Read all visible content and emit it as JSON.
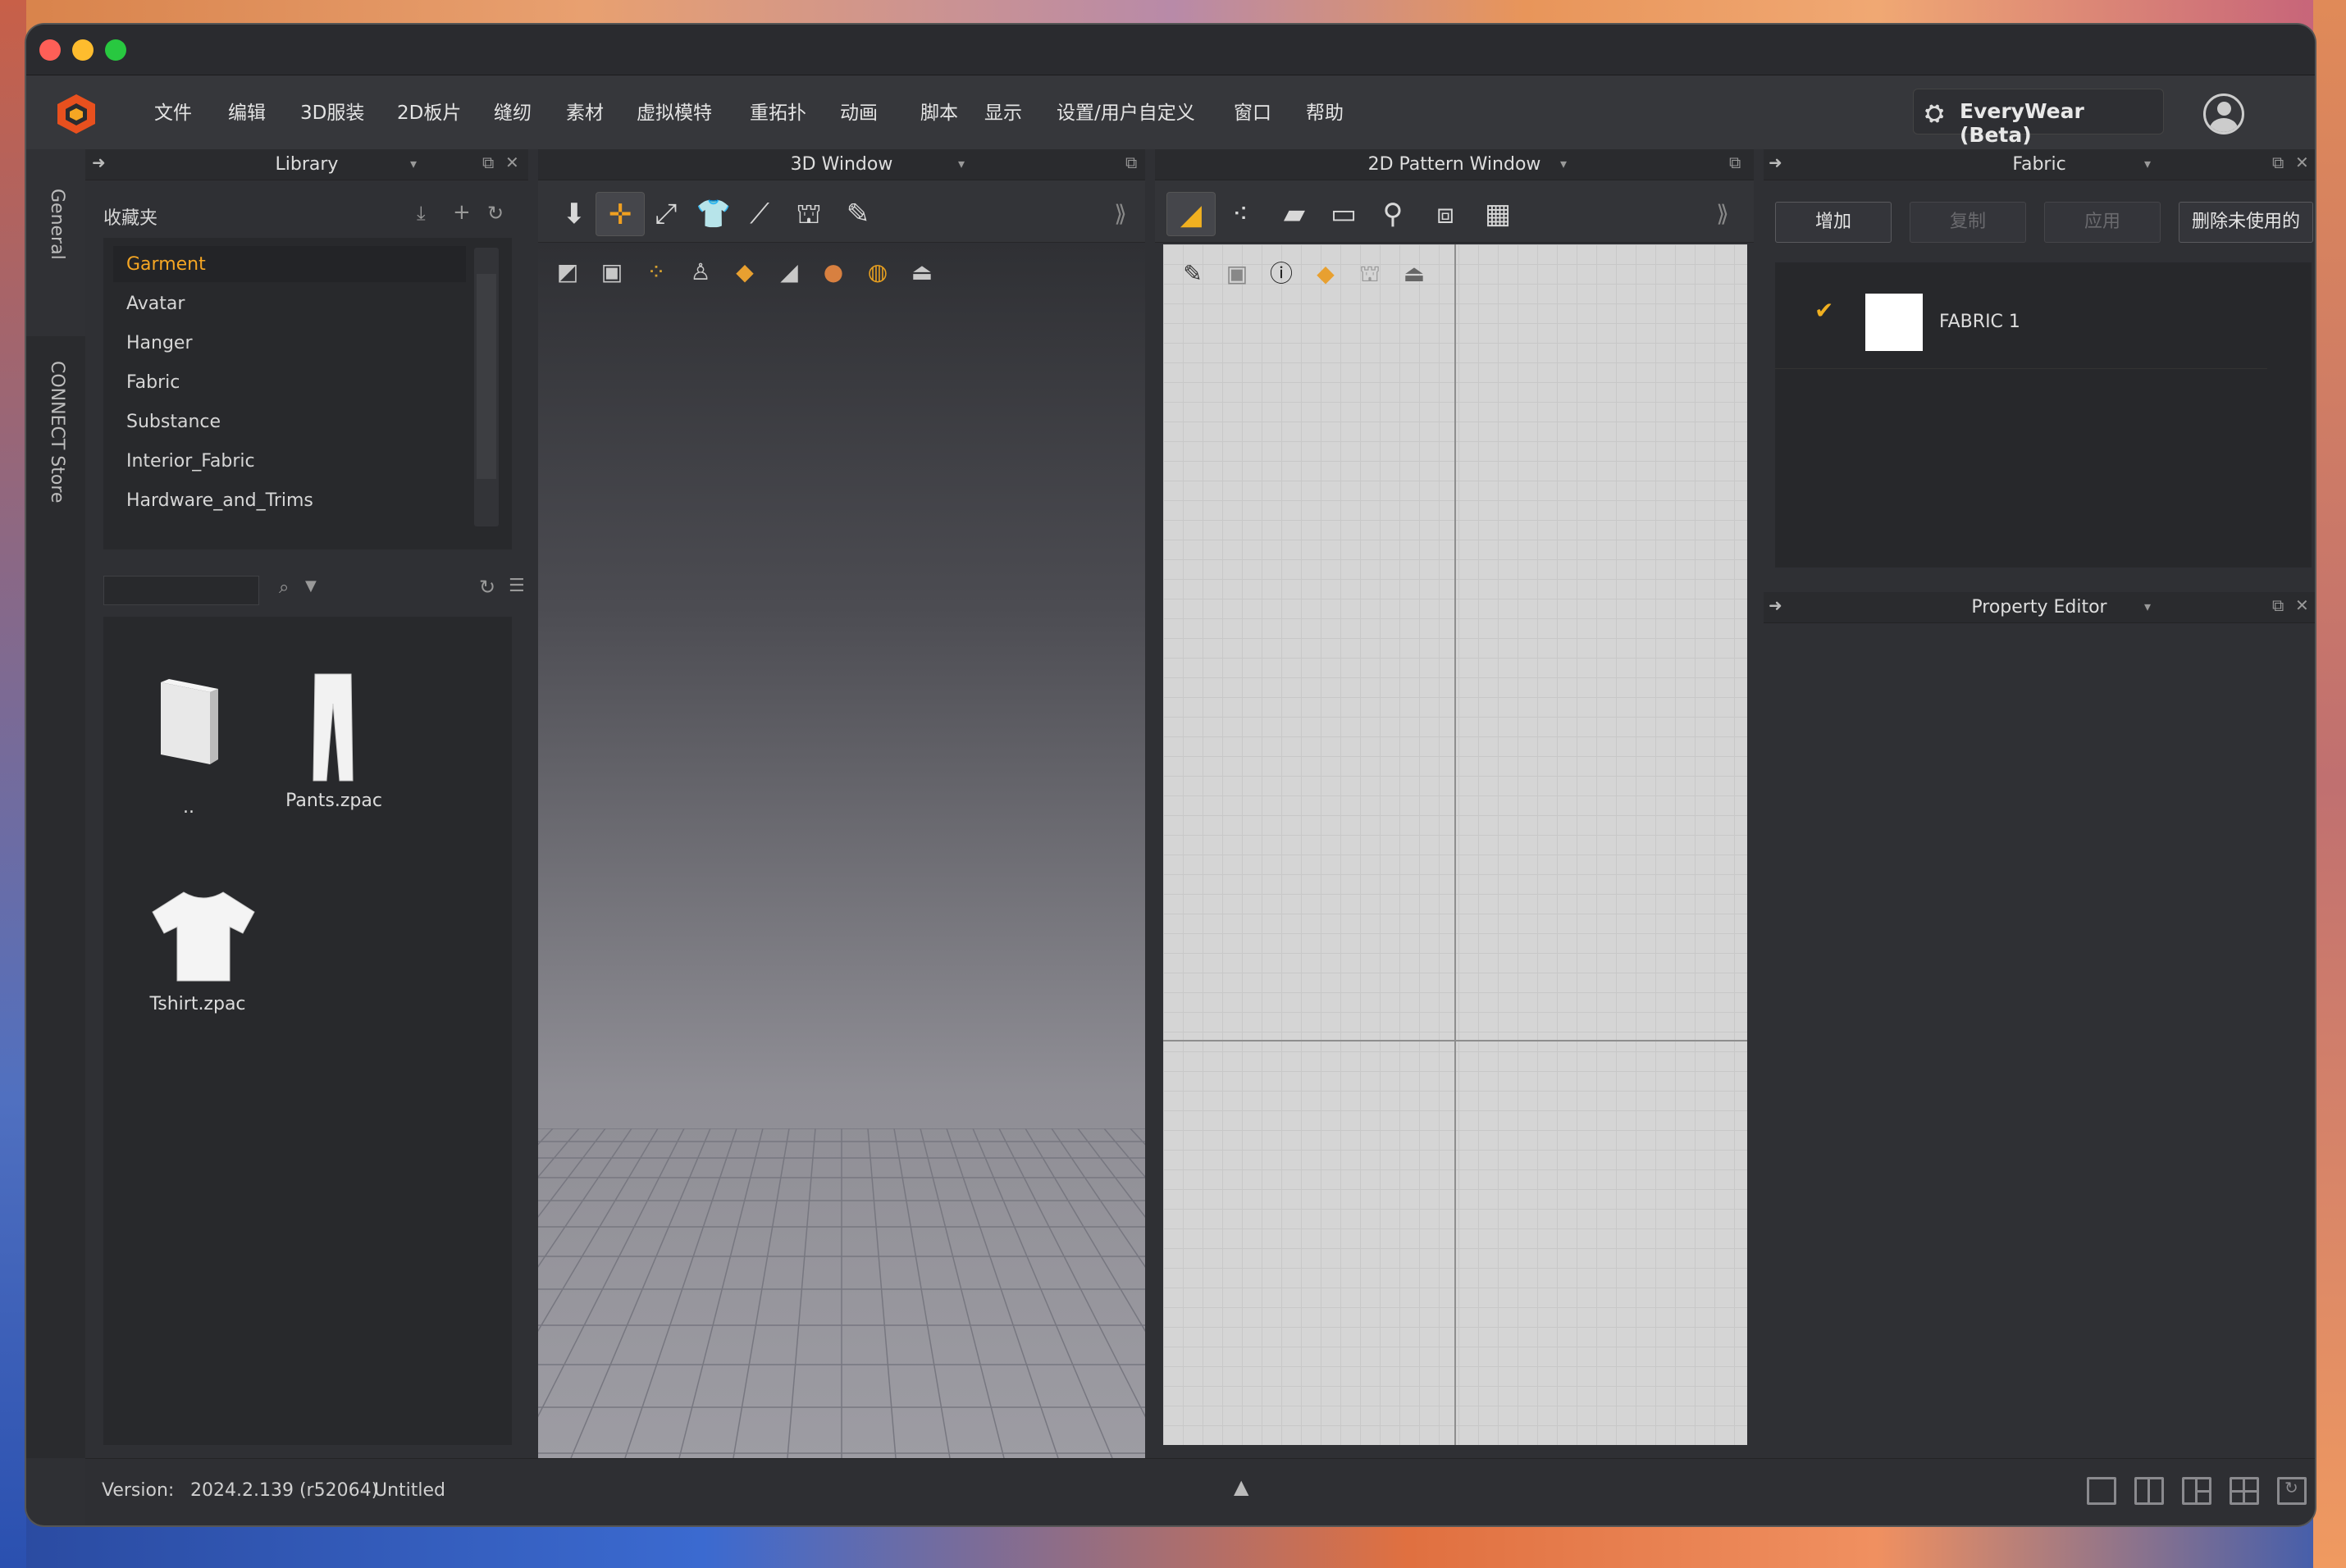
{
  "menu": [
    "文件",
    "编辑",
    "3D服装",
    "2D板片",
    "缝纫",
    "素材",
    "虚拟模特",
    "重拓扑",
    "动画",
    "脚本",
    "显示",
    "设置/用户自定义",
    "窗口",
    "帮助"
  ],
  "everywear": "EveryWear (Beta)",
  "sidetabs": {
    "general": "General",
    "connect": "CONNECT Store"
  },
  "library": {
    "title": "Library",
    "favorites_label": "收藏夹",
    "favorites": [
      "Garment",
      "Avatar",
      "Hanger",
      "Fabric",
      "Substance",
      "Interior_Fabric",
      "Hardware_and_Trims"
    ],
    "selected": "Garment",
    "search_placeholder": "",
    "files": [
      {
        "name": "..",
        "icon": "folder-icon"
      },
      {
        "name": "Pants.zpac",
        "icon": "pants-icon"
      },
      {
        "name": "Tshirt.zpac",
        "icon": "tshirt-icon"
      }
    ]
  },
  "window3d": {
    "title": "3D Window"
  },
  "window2d": {
    "title": "2D Pattern Window"
  },
  "fabric": {
    "title": "Fabric",
    "buttons": {
      "add": "增加",
      "copy": "复制",
      "apply": "应用",
      "delete_unused": "删除未使用的"
    },
    "items": [
      {
        "name": "FABRIC 1",
        "color": "#ffffff",
        "checked": true
      }
    ]
  },
  "property_editor": {
    "title": "Property Editor"
  },
  "status": {
    "version_label": "Version:",
    "version": "2024.2.139 (r52064)",
    "file": "Untitled"
  },
  "colors": {
    "accent": "#f0a020",
    "selected_text": "#f5a623"
  }
}
